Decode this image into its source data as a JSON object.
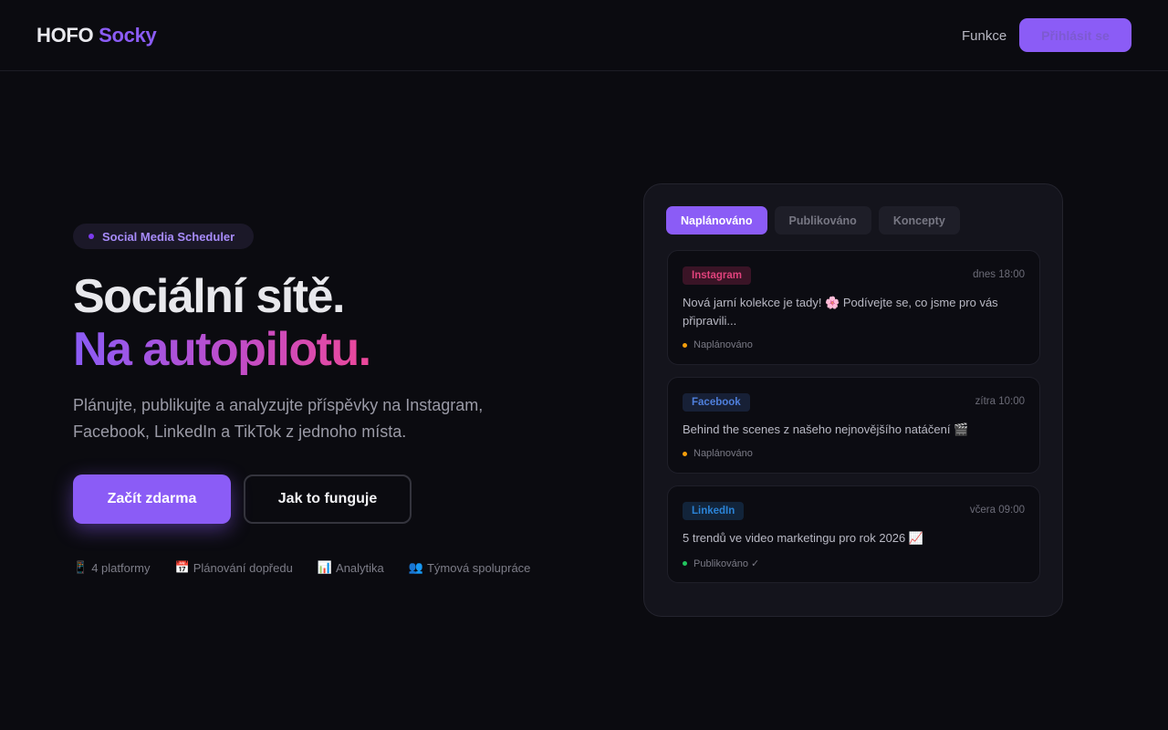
{
  "header": {
    "logo_primary": "HOFO",
    "logo_accent": "Socky",
    "nav_link": "Funkce",
    "login_button": "Přihlásit se"
  },
  "hero": {
    "badge": "Social Media Scheduler",
    "title_line1": "Sociální sítě.",
    "title_line2": "Na autopilotu.",
    "lead": "Plánujte, publikujte a analyzujte příspěvky na Instagram, Facebook, LinkedIn a TikTok z jednoho místa.",
    "primary_button": "Začít zdarma",
    "secondary_button": "Jak to funguje",
    "features": [
      {
        "icon": "📱",
        "icon_name": "mobile-phone-icon",
        "label": "4 platformy"
      },
      {
        "icon": "📅",
        "icon_name": "calendar-icon",
        "label": "Plánování dopředu"
      },
      {
        "icon": "📊",
        "icon_name": "bar-chart-icon",
        "label": "Analytika"
      },
      {
        "icon": "👥",
        "icon_name": "people-icon",
        "label": "Týmová spolupráce"
      }
    ]
  },
  "panel": {
    "tabs": [
      {
        "label": "Naplánováno",
        "active": true
      },
      {
        "label": "Publikováno",
        "active": false
      },
      {
        "label": "Koncepty",
        "active": false
      }
    ],
    "posts": [
      {
        "platform": "Instagram",
        "time": "dnes 18:00",
        "text": "Nová jarní kolekce je tady! 🌸 Podívejte se, co jsme pro vás připravili...",
        "status": "Naplánováno",
        "status_color": "#f59e0b"
      },
      {
        "platform": "Facebook",
        "time": "zítra 10:00",
        "text": "Behind the scenes z našeho nejnovějšího natáčení 🎬",
        "status": "Naplánováno",
        "status_color": "#f59e0b"
      },
      {
        "platform": "LinkedIn",
        "time": "včera 09:00",
        "text": "5 trendů ve video marketingu pro rok 2026 📈",
        "status": "Publikováno ✓",
        "status_color": "#22c55e"
      }
    ]
  },
  "colors": {
    "accent": "#8b5cf6",
    "background": "#0b0b10",
    "gradient_end": "#ec4899"
  }
}
